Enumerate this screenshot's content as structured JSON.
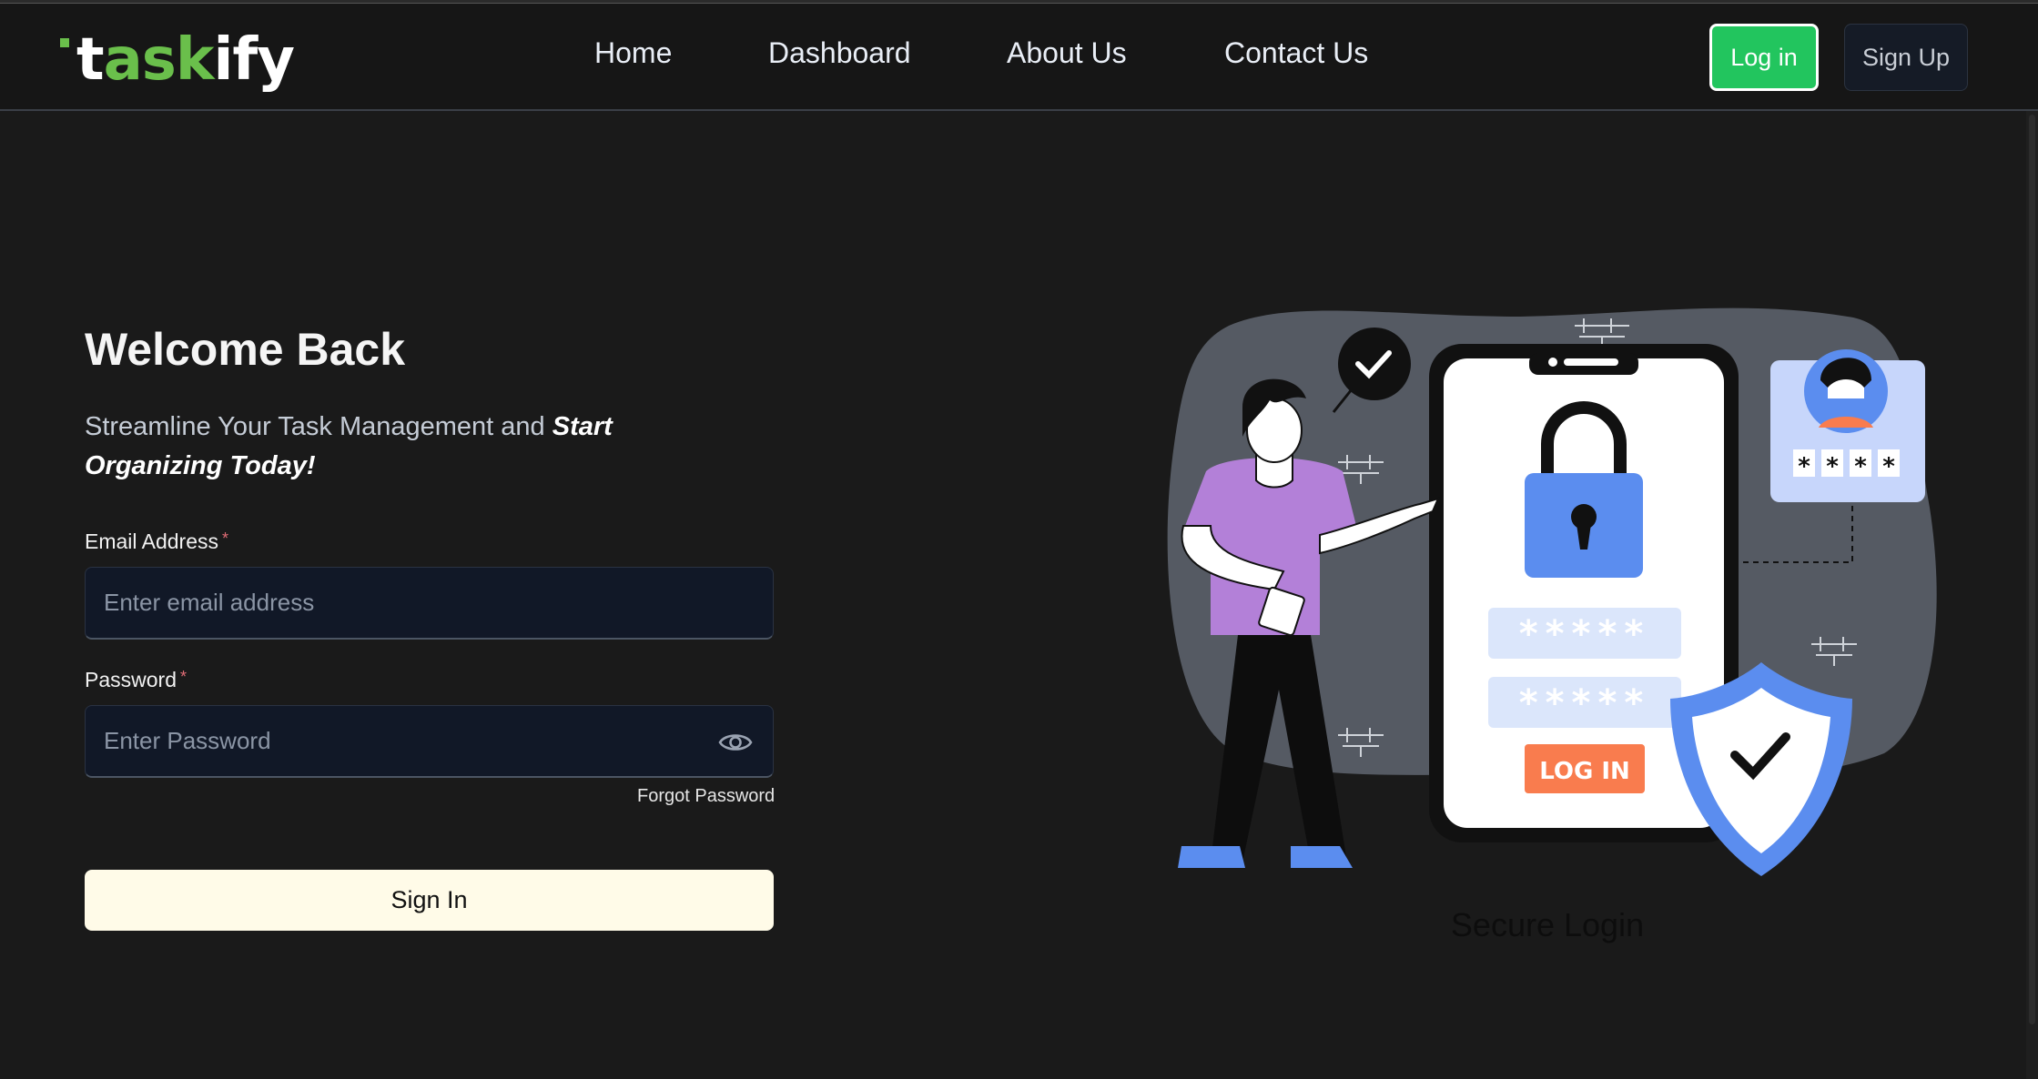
{
  "brand": {
    "logo_letters": [
      "t",
      "ask",
      "ify"
    ],
    "accent": "#6abf4b"
  },
  "nav": {
    "links": [
      "Home",
      "Dashboard",
      "About Us",
      "Contact Us"
    ],
    "login_label": "Log in",
    "signup_label": "Sign Up"
  },
  "hero": {
    "title": "Welcome Back",
    "subtitle_plain": "Streamline Your Task Management and ",
    "subtitle_emphasis": "Start Organizing Today!"
  },
  "form": {
    "email_label": "Email Address",
    "email_placeholder": "Enter email address",
    "password_label": "Password",
    "password_placeholder": "Enter Password",
    "required_mark": "*",
    "forgot_label": "Forgot Password",
    "submit_label": "Sign In"
  },
  "illustration": {
    "phone_button_label": "LOG IN",
    "password_mask": "*****",
    "pin_mask": [
      "*",
      "*",
      "*",
      "*"
    ],
    "caption": "Secure Login"
  },
  "colors": {
    "login_button": "#22c55e",
    "signin_button": "#fffbe8",
    "illustration_blob": "#555a63",
    "lock_blue": "#5b8def",
    "phone_login": "#f97c4e",
    "shirt_purple": "#b380d8"
  }
}
